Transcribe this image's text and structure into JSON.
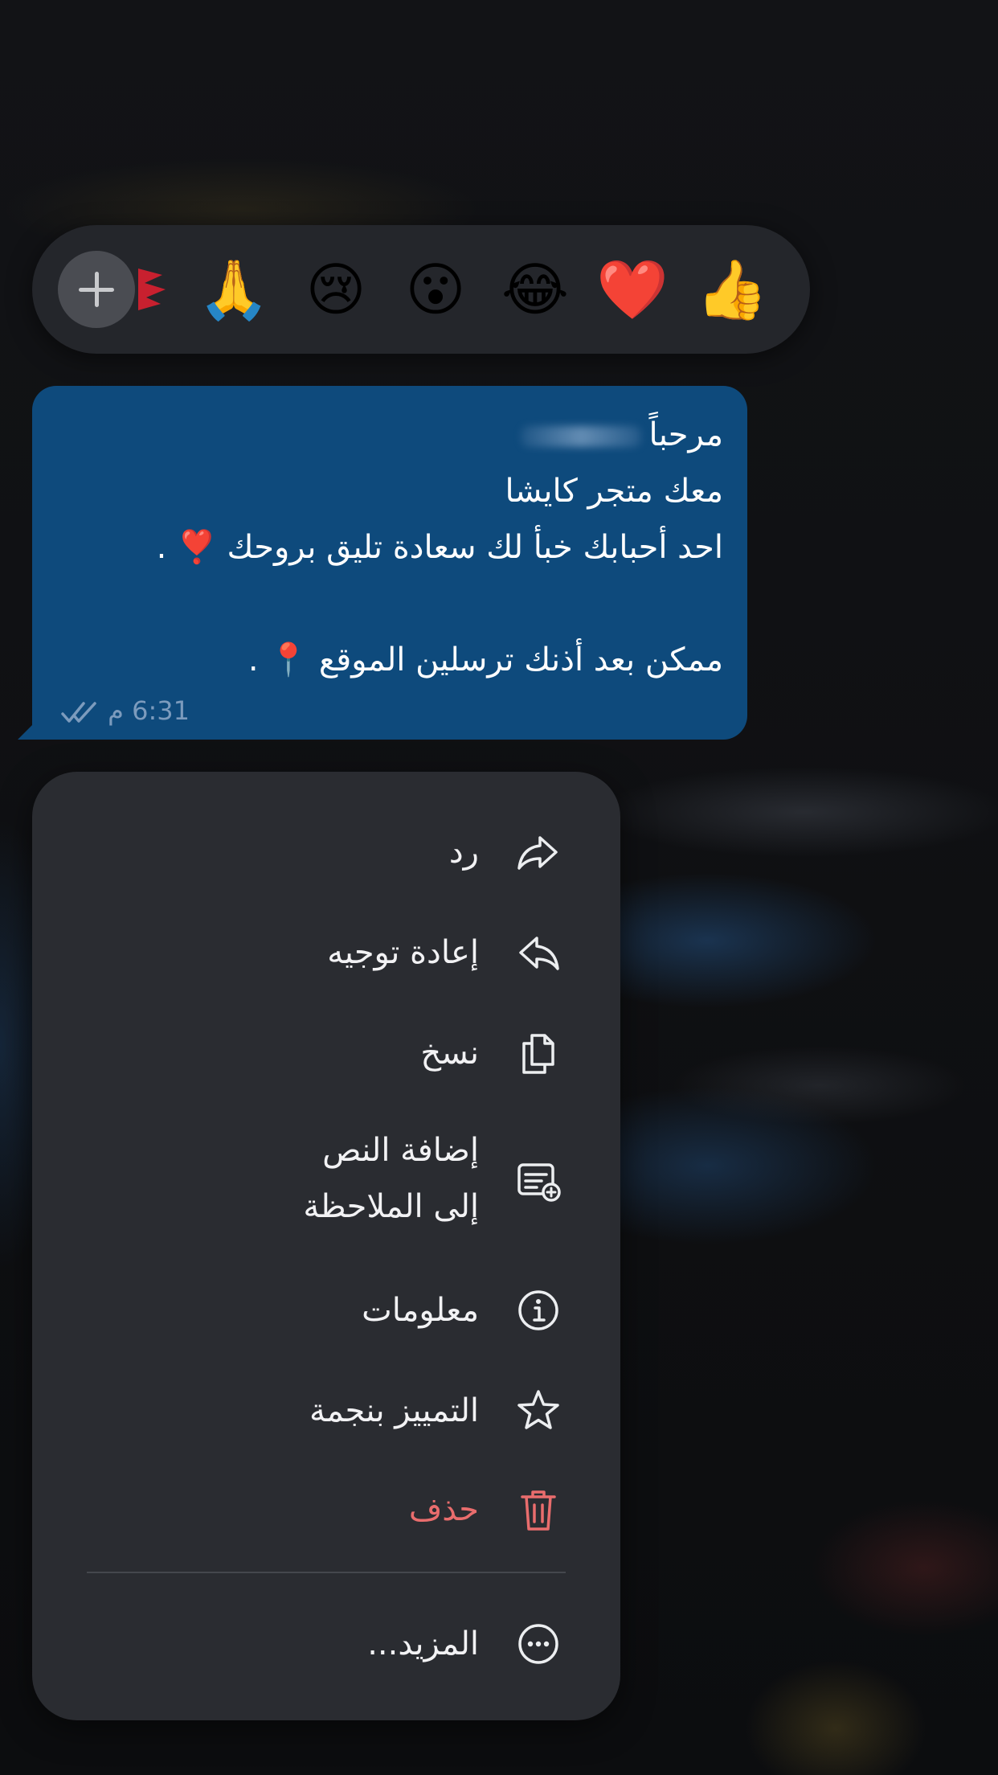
{
  "reactions": {
    "emojis": [
      "👍",
      "❤️",
      "😂",
      "😮",
      "😢",
      "🙏"
    ],
    "more_button": "+"
  },
  "message": {
    "lines": [
      "مرحباً",
      "معك متجر كايشا",
      "احد أحبابك خبأ لك سعادة تليق بروحك ❣️ .",
      "",
      "ممكن بعد أذنك ترسلين الموقع 📍 ."
    ],
    "time": "6:31 م"
  },
  "menu": {
    "items": [
      {
        "label": "رد",
        "icon": "reply-icon"
      },
      {
        "label": "إعادة توجيه",
        "icon": "forward-icon"
      },
      {
        "label": "نسخ",
        "icon": "copy-icon"
      },
      {
        "label": "إضافة النص",
        "label2": "إلى الملاحظة",
        "icon": "note-add-icon"
      },
      {
        "label": "معلومات",
        "icon": "info-icon"
      },
      {
        "label": "التمييز بنجمة",
        "icon": "star-icon"
      },
      {
        "label": "حذف",
        "icon": "trash-icon",
        "color": "#e96d6d"
      },
      {
        "label": "المزيد...",
        "icon": "more-icon"
      }
    ]
  },
  "colors": {
    "bubble": "#0e4a7c",
    "menu": "#2a2c31",
    "danger": "#e96d6d"
  }
}
